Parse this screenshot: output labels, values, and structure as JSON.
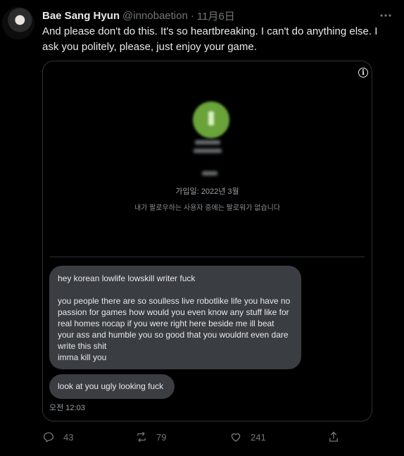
{
  "author": {
    "name": "Bae Sang Hyun",
    "handle": "@innobaetion",
    "separator": "·",
    "date": "11月6日"
  },
  "tweet": {
    "text": "And please don't do this. It's so heartbreaking. I can't do anything else. I ask you politely, please, just enjoy your game."
  },
  "media": {
    "profile": {
      "joined": "가입일: 2022년 3월",
      "no_followers": "내가 팔로우하는 사용자 중에는 팔로워가 없습니다"
    },
    "messages": [
      {
        "lines": [
          "hey korean lowlife lowskill writer fuck",
          "",
          "you people there are so soulless live robotlike life you have no passion for games how would you even know any stuff like for real homes nocap if you were right here beside me ill beat your ass and humble you so good that you wouldnt even dare write this shit",
          "imma kill you"
        ]
      },
      {
        "text": "look at you ugly looking fuck"
      }
    ],
    "timestamp": "오전 12:03"
  },
  "actions": {
    "reply_count": "43",
    "retweet_count": "79",
    "like_count": "241"
  },
  "icons": [
    "more-icon",
    "info-icon",
    "reply-icon",
    "retweet-icon",
    "like-icon",
    "share-icon"
  ]
}
